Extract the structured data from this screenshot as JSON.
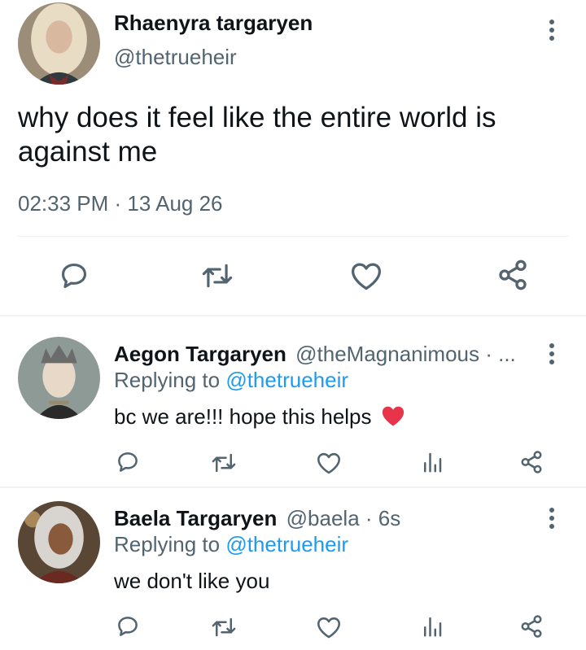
{
  "main_tweet": {
    "author_name": "Rhaenyra targaryen",
    "handle": "@thetrueheir",
    "text": "why does it feel like the entire world is against me",
    "timestamp": "02:33 PM · 13 Aug 26",
    "actions": [
      "reply-icon",
      "retweet-icon",
      "like-icon",
      "share-icon"
    ]
  },
  "replies": [
    {
      "author_name": "Aegon Targaryen",
      "handle_meta": "@theMagnanimous · ...",
      "replying_prefix": "Replying to ",
      "replying_to": "@thetrueheir",
      "text": "bc we are!!! hope this helps",
      "emoji": "❤️",
      "actions": [
        "reply-icon",
        "retweet-icon",
        "like-icon",
        "views-icon",
        "share-icon"
      ]
    },
    {
      "author_name": "Baela Targaryen",
      "handle_meta": "@baela · 6s",
      "replying_prefix": "Replying to ",
      "replying_to": "@thetrueheir",
      "text": "we don't like you",
      "actions": [
        "reply-icon",
        "retweet-icon",
        "like-icon",
        "views-icon",
        "share-icon"
      ]
    }
  ],
  "colors": {
    "text": "#0f1419",
    "muted": "#536471",
    "link": "#1d9bf0",
    "divider": "#eff3f4",
    "heart_emoji": "#e8344a"
  }
}
